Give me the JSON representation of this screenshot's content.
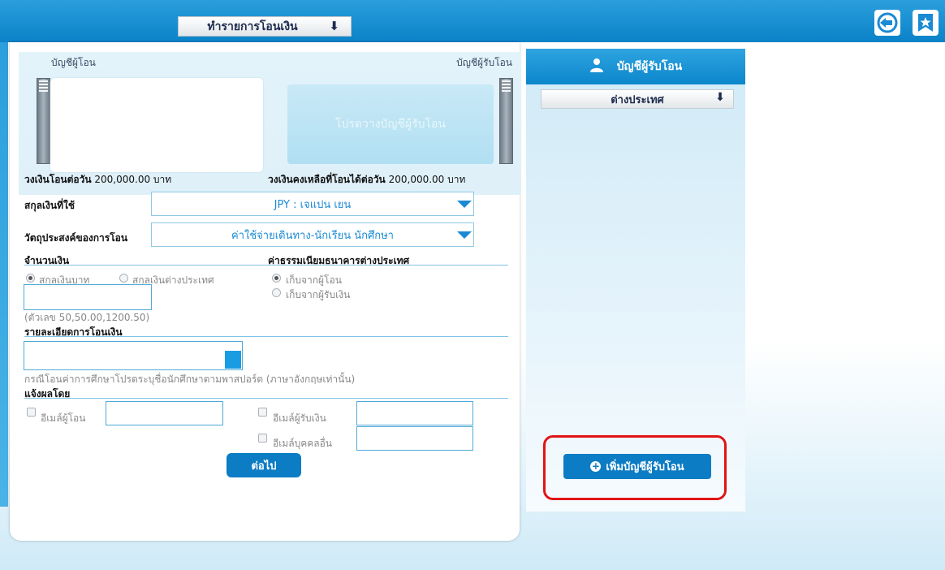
{
  "topbar": {
    "menu_label": "ทำรายการโอนเงิน",
    "back_icon": "logout-back-icon",
    "bookmark_icon": "bookmark-star-icon"
  },
  "accounts": {
    "from_label": "บัญชีผู้โอน",
    "to_label": "บัญชีผู้รับโอน",
    "to_placeholder": "โปรดวางบัญชีผู้รับโอน"
  },
  "limits": {
    "daily_label": "วงเงินโอนต่อวัน",
    "daily_value": "200,000.00 บาท",
    "remaining_label": "วงเงินคงเหลือที่โอนได้ต่อวัน",
    "remaining_value": "200,000.00 บาท"
  },
  "currency": {
    "label": "สกุลเงินที่ใช้",
    "value": "JPY : เจแปน เยน"
  },
  "purpose": {
    "label": "วัตถุประสงค์ของการโอน",
    "value": "ค่าใช้จ่ายเดินทาง-นักเรียน นักศึกษา"
  },
  "amount": {
    "section": "จำนวนเงิน",
    "opt_thb": "สกุลเงินบาท",
    "opt_foreign": "สกุลเงินต่างประเทศ",
    "hint": "(ตัวเลข 50,50.00,1200.50)"
  },
  "fee": {
    "section": "ค่าธรรมเนียมธนาคารต่างประเทศ",
    "opt_sender": "เก็บจากผู้โอน",
    "opt_receiver": "เก็บจากผู้รับเงิน"
  },
  "details": {
    "section": "รายละเอียดการโอนเงิน",
    "note": "กรณีโอนค่าการศึกษาโปรดระบุชื่อนักศึกษาตามพาสปอร์ต (ภาษาอังกฤษเท่านั้น)"
  },
  "notify": {
    "section": "แจ้งผลโดย",
    "email_sender": "อีเมล์ผู้โอน",
    "email_receiver": "อีเมล์ผู้รับเงิน",
    "email_other": "อีเมล์บุคคลอื่น"
  },
  "next_button": "ต่อไป",
  "right_panel": {
    "title": "บัญชีผู้รับโอน",
    "filter_value": "ต่างประเทศ",
    "add_button": "เพิ่มบัญชีผู้รับโอน"
  },
  "colors": {
    "primary_blue": "#0c7cc4",
    "highlight_red": "#e01515"
  }
}
